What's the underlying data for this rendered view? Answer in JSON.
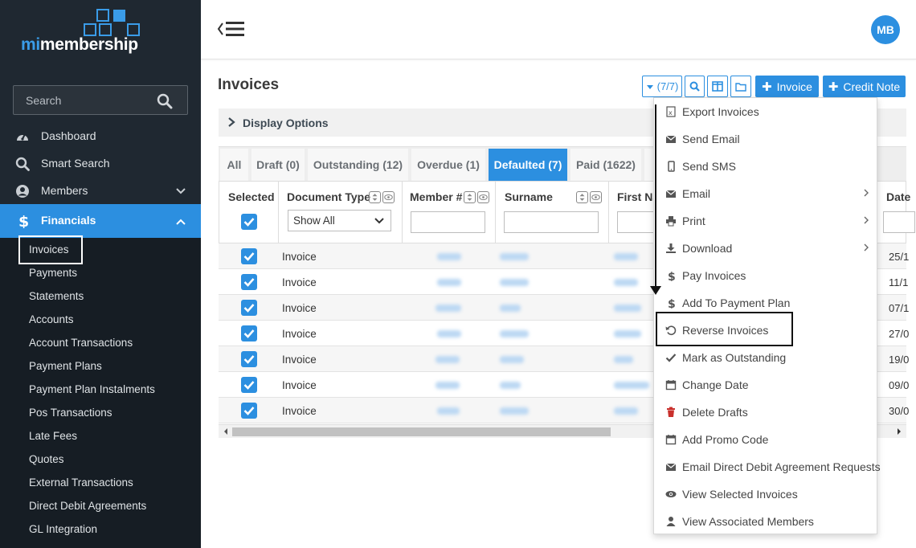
{
  "brand": {
    "logo_prefix": "mi",
    "logo_suffix": "membership",
    "accent": "#2c8fe0"
  },
  "sidebar": {
    "search_placeholder": "Search",
    "nav": [
      {
        "label": "Dashboard",
        "icon": "dashboard-icon"
      },
      {
        "label": "Smart Search",
        "icon": "search-icon"
      },
      {
        "label": "Members",
        "icon": "user-circle-icon"
      },
      {
        "label": "Financials",
        "icon": "dollar-icon"
      }
    ],
    "submenu": [
      "Invoices",
      "Payments",
      "Statements",
      "Accounts",
      "Account Transactions",
      "Payment Plans",
      "Payment Plan Instalments",
      "Pos Transactions",
      "Late Fees",
      "Quotes",
      "External Transactions",
      "Direct Debit Agreements",
      "GL Integration"
    ]
  },
  "header": {
    "avatar_initials": "MB"
  },
  "page": {
    "title": "Invoices"
  },
  "toolbar": {
    "count_label": "(7/7)",
    "invoice_label": "Invoice",
    "credit_note_label": "Credit Note"
  },
  "display_options": {
    "label": "Display Options"
  },
  "tabs": [
    {
      "label": "All"
    },
    {
      "label": "Draft (0)"
    },
    {
      "label": "Outstanding (12)"
    },
    {
      "label": "Overdue (1)"
    },
    {
      "label": "Defaulted (7)"
    },
    {
      "label": "Paid (1622)"
    }
  ],
  "table": {
    "columns": {
      "selected": "Selected",
      "document_type": "Document Type",
      "member_no": "Member #",
      "surname": "Surname",
      "first_name": "First Na",
      "date": "Date"
    },
    "document_type_filter": "Show All",
    "rows": [
      {
        "doc": "Invoice",
        "date": "25/1"
      },
      {
        "doc": "Invoice",
        "date": "11/1"
      },
      {
        "doc": "Invoice",
        "date": "07/1"
      },
      {
        "doc": "Invoice",
        "date": "27/0"
      },
      {
        "doc": "Invoice",
        "date": "19/0"
      },
      {
        "doc": "Invoice",
        "date": "09/0"
      },
      {
        "doc": "Invoice",
        "date": "30/0"
      }
    ]
  },
  "dropdown": {
    "items": [
      {
        "label": "Export Invoices",
        "icon": "excel-file-icon",
        "submenu": false
      },
      {
        "label": "Send Email",
        "icon": "envelope-icon",
        "submenu": false
      },
      {
        "label": "Send SMS",
        "icon": "mobile-icon",
        "submenu": false
      },
      {
        "label": "Email",
        "icon": "envelope-icon",
        "submenu": true
      },
      {
        "label": "Print",
        "icon": "printer-icon",
        "submenu": true
      },
      {
        "label": "Download",
        "icon": "download-icon",
        "submenu": true
      },
      {
        "label": "Pay Invoices",
        "icon": "dollar-icon",
        "submenu": false
      },
      {
        "label": "Add To Payment Plan",
        "icon": "dollar-icon",
        "submenu": false
      },
      {
        "label": "Reverse Invoices",
        "icon": "undo-icon",
        "submenu": false
      },
      {
        "label": "Mark as Outstanding",
        "icon": "check-icon",
        "submenu": false
      },
      {
        "label": "Change Date",
        "icon": "calendar-icon",
        "submenu": false
      },
      {
        "label": "Delete Drafts",
        "icon": "trash-icon",
        "submenu": false
      },
      {
        "label": "Add Promo Code",
        "icon": "calendar-icon",
        "submenu": false
      },
      {
        "label": "Email Direct Debit Agreement Requests",
        "icon": "envelope-icon",
        "submenu": false
      },
      {
        "label": "View Selected Invoices",
        "icon": "eye-icon",
        "submenu": false
      },
      {
        "label": "View Associated Members",
        "icon": "user-icon",
        "submenu": false
      }
    ]
  }
}
